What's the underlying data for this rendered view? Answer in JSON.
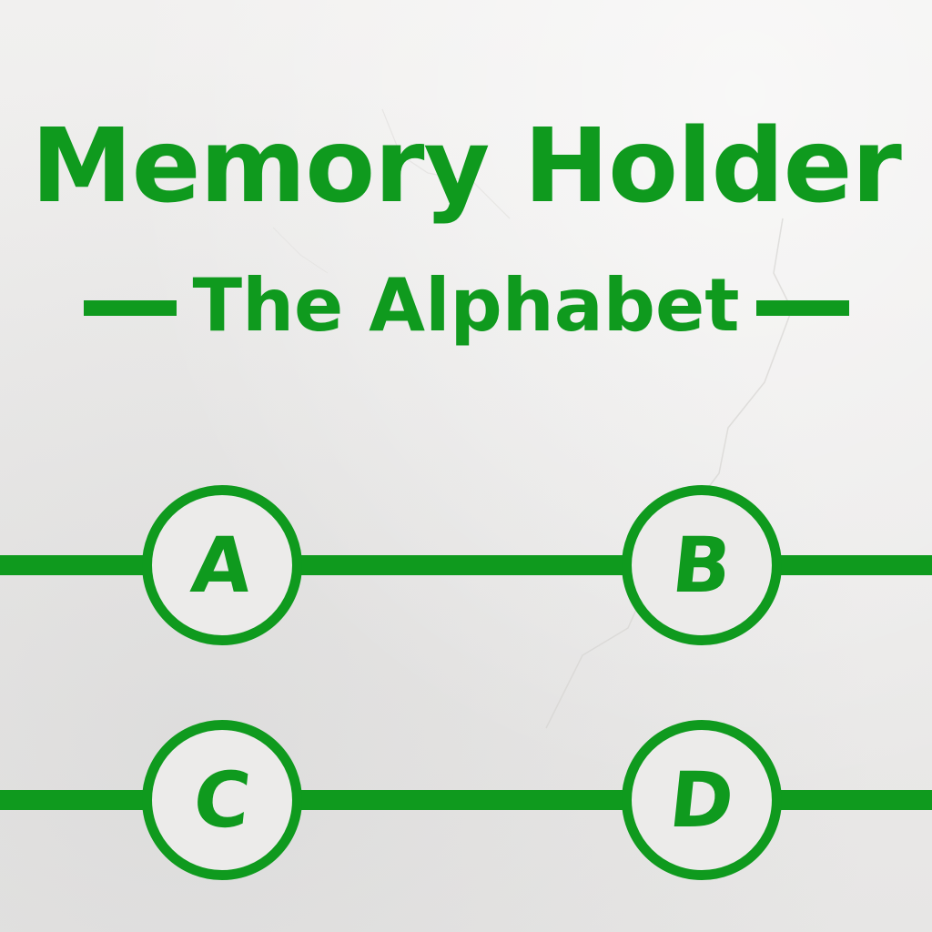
{
  "title": "Memory Holder",
  "subtitle": "The Alphabet",
  "letters": [
    "A",
    "B",
    "C",
    "D"
  ],
  "colors": {
    "accent": "#0f9a1e",
    "background": "#ecebea"
  }
}
